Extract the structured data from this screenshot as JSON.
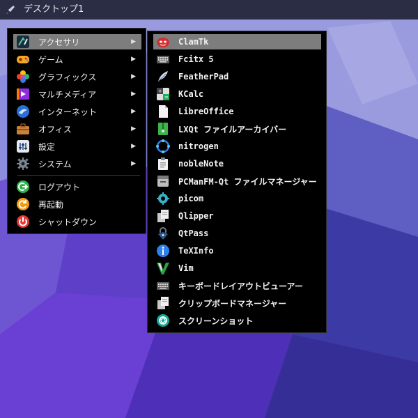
{
  "taskbar": {
    "title": "デスクトップ1",
    "icon": "rocket-icon"
  },
  "colors": {
    "bg_dark": "#3b2a8a",
    "bg_light": "#6a63c9",
    "menu_bg": "#000000",
    "selected": "#7d7d7d"
  },
  "main_menu": {
    "categories": [
      {
        "label": "アクセサリ",
        "icon": "accessories-icon",
        "arrow": "▶"
      },
      {
        "label": "ゲーム",
        "icon": "gamepad-icon",
        "arrow": "▶"
      },
      {
        "label": "グラフィックス",
        "icon": "graphics-icon",
        "arrow": "▶"
      },
      {
        "label": "マルチメディア",
        "icon": "multimedia-icon",
        "arrow": "▶"
      },
      {
        "label": "インターネット",
        "icon": "internet-icon",
        "arrow": "▶"
      },
      {
        "label": "オフィス",
        "icon": "office-icon",
        "arrow": "▶"
      },
      {
        "label": "設定",
        "icon": "settings-icon",
        "arrow": "▶"
      },
      {
        "label": "システム",
        "icon": "system-gear-icon",
        "arrow": "▶"
      }
    ],
    "actions": [
      {
        "label": "ログアウト",
        "icon": "logout-icon"
      },
      {
        "label": "再起動",
        "icon": "reboot-icon"
      },
      {
        "label": "シャットダウン",
        "icon": "power-icon"
      }
    ]
  },
  "submenu": {
    "items": [
      {
        "label": "ClamTk",
        "icon": "clamtk-icon"
      },
      {
        "label": "Fcitx 5",
        "icon": "keyboard-icon"
      },
      {
        "label": "FeatherPad",
        "icon": "feather-icon"
      },
      {
        "label": "KCalc",
        "icon": "calculator-icon"
      },
      {
        "label": "LibreOffice",
        "icon": "document-icon"
      },
      {
        "label": "LXQt ファイルアーカイバー",
        "icon": "archive-icon"
      },
      {
        "label": "nitrogen",
        "icon": "nitrogen-icon"
      },
      {
        "label": "nobleNote",
        "icon": "clipboard-note-icon"
      },
      {
        "label": "PCManFM-Qt ファイルマネージャー",
        "icon": "file-manager-icon"
      },
      {
        "label": "picom",
        "icon": "picom-gear-icon"
      },
      {
        "label": "Qlipper",
        "icon": "clipboard-copy-icon"
      },
      {
        "label": "QtPass",
        "icon": "lock-icon"
      },
      {
        "label": "TeXInfo",
        "icon": "info-icon"
      },
      {
        "label": "Vim",
        "icon": "vim-icon"
      },
      {
        "label": "キーボードレイアウトビューアー",
        "icon": "keyboard-icon"
      },
      {
        "label": "クリップボードマネージャー",
        "icon": "clipboard-copy-icon"
      },
      {
        "label": "スクリーンショット",
        "icon": "camera-aperture-icon"
      }
    ]
  }
}
